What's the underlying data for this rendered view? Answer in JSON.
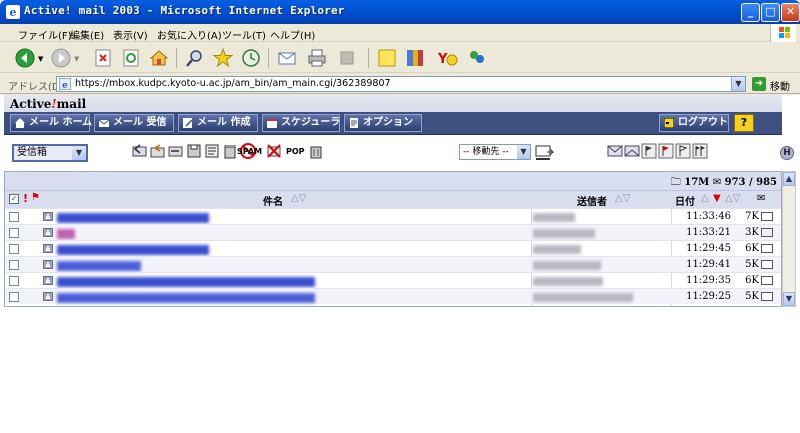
{
  "window": {
    "title": "Active! mail 2003 - Microsoft Internet Explorer",
    "minimize": "_",
    "maximize": "□",
    "close": "✕"
  },
  "menu": [
    "ファイル(F)",
    "編集(E)",
    "表示(V)",
    "お気に入り(A)",
    "ツール(T)",
    "ヘルプ(H)"
  ],
  "address": {
    "label": "アドレス(D)",
    "url": "https://mbox.kudpc.kyoto-u.ac.jp/am_bin/am_main.cgi/362389807",
    "go_label": "移動"
  },
  "app": {
    "logo_prefix": "Active",
    "logo_mark": "!",
    "logo_suffix": "mail",
    "nav": [
      "メール ホーム",
      "メール 受信",
      "メール 作成",
      "スケジューラ",
      "オプション"
    ],
    "logout": "ログアウト",
    "help": "?"
  },
  "actions": {
    "folder": "受信箱",
    "spam": "SPAM",
    "pop": "POP",
    "move": "-- 移動先 --",
    "h_button": "H"
  },
  "list": {
    "folder_size": "17M",
    "message_count": "973 / 985",
    "col_subject": "件名",
    "col_sender": "送信者",
    "col_date": "日付",
    "rows": [
      {
        "time": "11:33:46",
        "size": "7K",
        "opened": false
      },
      {
        "time": "11:33:21",
        "size": "3K",
        "opened": true
      },
      {
        "time": "11:29:45",
        "size": "6K",
        "opened": false
      },
      {
        "time": "11:29:41",
        "size": "5K",
        "opened": false
      },
      {
        "time": "11:29:35",
        "size": "6K",
        "opened": false
      },
      {
        "time": "11:29:25",
        "size": "5K",
        "opened": false
      }
    ]
  },
  "colors": {
    "titlebar": "#0052d4",
    "navbar": "#3d5080",
    "list_header": "#d9deef",
    "blurred_link": "#3a4fd0"
  }
}
